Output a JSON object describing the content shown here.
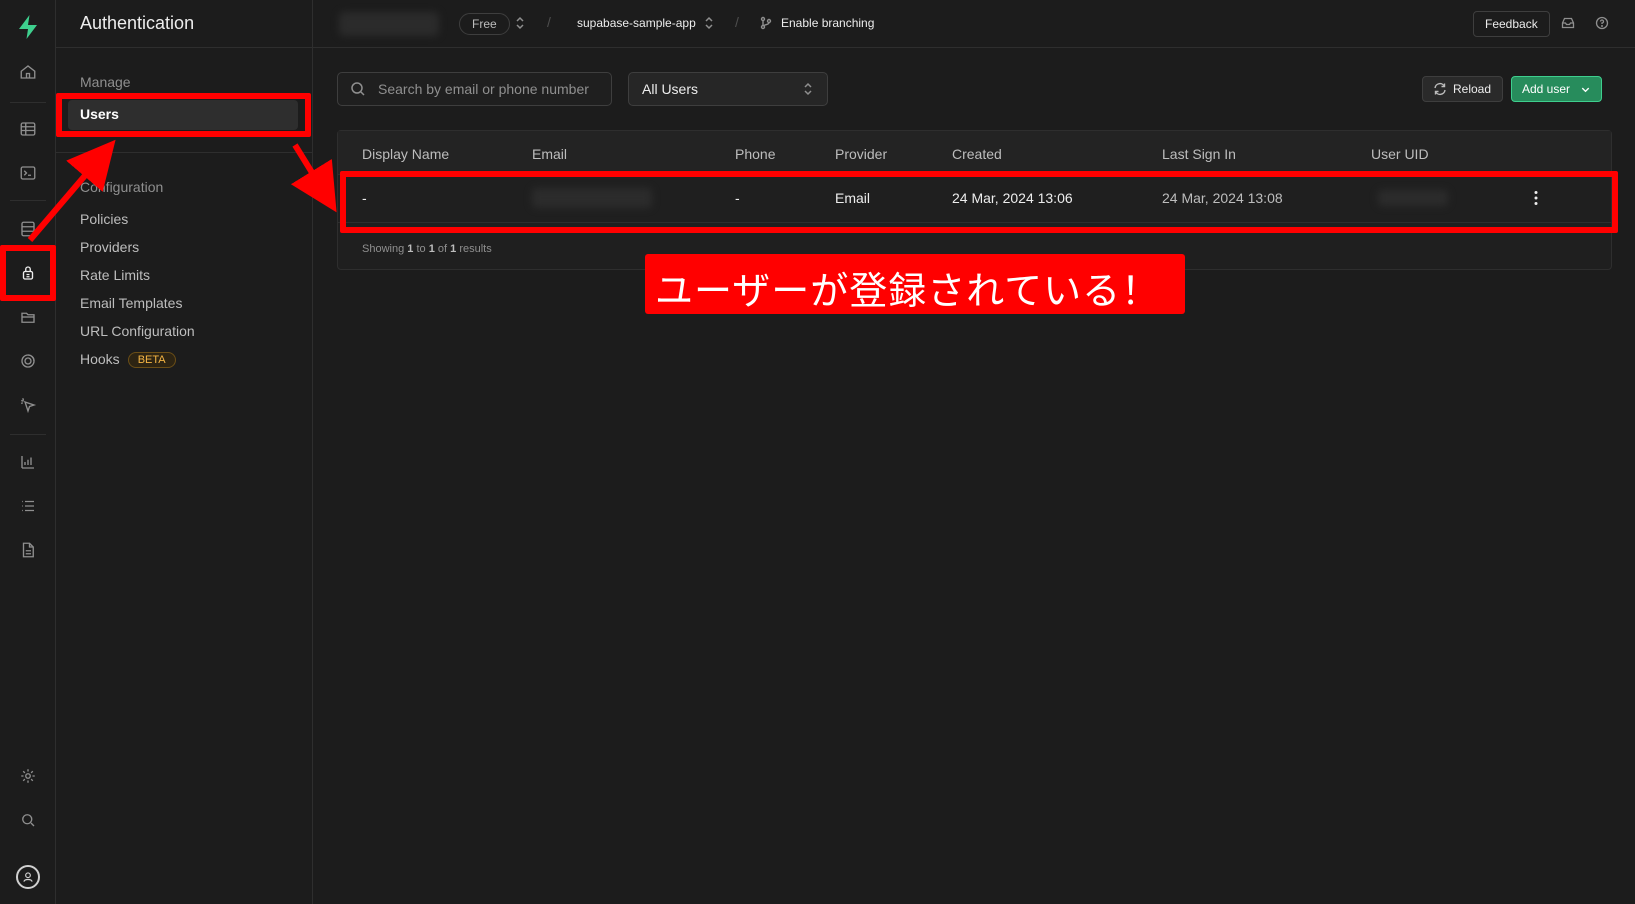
{
  "topbar": {
    "plan_badge": "Free",
    "project_name": "supabase-sample-app",
    "branching_label": "Enable branching",
    "feedback_label": "Feedback"
  },
  "sidebar": {
    "title": "Authentication",
    "manage_heading": "Manage",
    "manage_items": [
      {
        "label": "Users",
        "active": true
      }
    ],
    "config_heading": "Configuration",
    "config_items": [
      {
        "label": "Policies"
      },
      {
        "label": "Providers"
      },
      {
        "label": "Rate Limits"
      },
      {
        "label": "Email Templates"
      },
      {
        "label": "URL Configuration"
      },
      {
        "label": "Hooks",
        "badge": "BETA"
      }
    ]
  },
  "toolbar": {
    "search_placeholder": "Search by email or phone number",
    "filter_value": "All Users",
    "reload_label": "Reload",
    "add_user_label": "Add user"
  },
  "table": {
    "columns": [
      "Display Name",
      "Email",
      "Phone",
      "Provider",
      "Created",
      "Last Sign In",
      "User UID"
    ],
    "rows": [
      {
        "display_name": "-",
        "phone": "-",
        "provider": "Email",
        "created": "24 Mar, 2024 13:06",
        "last_sign_in": "24 Mar, 2024 13:08"
      }
    ],
    "footer": {
      "showing": "Showing",
      "from": "1",
      "to_word": "to",
      "to": "1",
      "of_word": "of",
      "total": "1",
      "results": "results"
    }
  },
  "annotation": {
    "callout_text": "ユーザーが登録されている！",
    "color": "#ff0000"
  },
  "colors": {
    "background": "#1c1c1c",
    "brand": "#3ecf8e",
    "add_button": "#278c5c",
    "beta_badge": "#f5b544"
  }
}
